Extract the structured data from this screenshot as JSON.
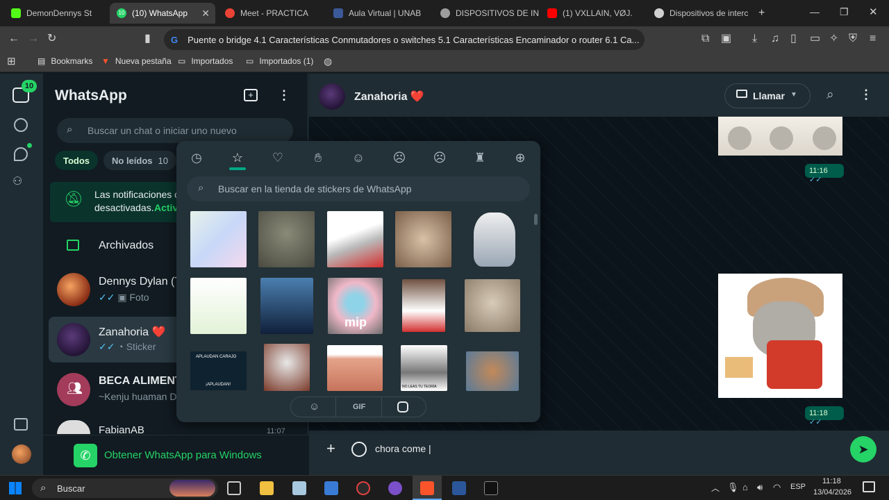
{
  "browser": {
    "tabs": [
      {
        "label": "DemonDennys St",
        "color": "#53fc18"
      },
      {
        "label": "(10) WhatsApp",
        "color": "#25d366",
        "active": true
      },
      {
        "label": "Meet - PRACTICA",
        "color": "#ea4335"
      },
      {
        "label": "Aula Virtual | UNAB",
        "color": "#3b5998"
      },
      {
        "label": "DISPOSITIVOS DE INT",
        "color": "#9e9e9e"
      },
      {
        "label": "(1) VXLLAIN, VØJ.",
        "color": "#ff0000"
      },
      {
        "label": "Dispositivos de interc",
        "color": "#d0d0d0"
      }
    ],
    "url": "Puente o bridge 4.1 Características Conmutadores o switches 5.1 Características Encaminador o router 6.1 Ca...",
    "bookmarks": [
      "Bookmarks",
      "Nueva pestaña",
      "Importados",
      "Importados (1)"
    ]
  },
  "rail": {
    "badge": "10"
  },
  "sidebar": {
    "title": "WhatsApp",
    "search_placeholder": "Buscar un chat o iniciar uno nuevo",
    "filters": [
      {
        "label": "Todos",
        "active": true
      },
      {
        "label": "No leídos",
        "count": "10"
      }
    ],
    "notice": {
      "line1": "Las notificaciones c",
      "line2": "desactivadas.",
      "link": "Activ"
    },
    "archived": "Archivados",
    "chats": [
      {
        "name": "Dennys Dylan (Tú",
        "preview": "Foto"
      },
      {
        "name": "Zanahoria ❤️",
        "preview": "Sticker"
      },
      {
        "name": "BECA ALIMENTA",
        "preview": "~Kenju huaman Do"
      },
      {
        "name": "FabianAB",
        "time": "11:07"
      }
    ],
    "promo": "Obtener WhatsApp para Windows"
  },
  "chat": {
    "contact": "Zanahoria ❤️",
    "call_label": "Llamar",
    "messages": [
      {
        "time": "11:16"
      },
      {
        "time": "11:18"
      }
    ],
    "composer_text": "chora come"
  },
  "picker": {
    "search_placeholder": "Buscar en la tienda de stickers de WhatsApp",
    "sticker_texts": {
      "s1": "mip",
      "s2": "APLAUDAN CARAJO",
      "s3": "¡APLAUDAN!",
      "s4": "NO LEAS TU TEORÍA"
    },
    "bottom_tabs": [
      "GIF"
    ]
  },
  "taskbar": {
    "search": "Buscar",
    "lang": "ESP",
    "time": "11:18",
    "date": "13/04/2026"
  },
  "colors": {
    "accent": "#00a884",
    "green": "#25d366",
    "bubble": "#005c4b"
  }
}
